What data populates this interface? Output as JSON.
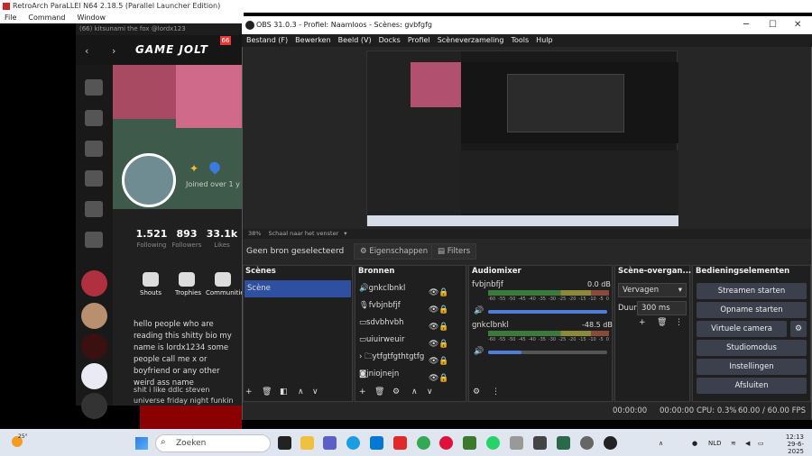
{
  "retroarch": {
    "title": "RetroArch ParaLLEl N64 2.18.5 (Parallel Launcher Edition)",
    "menu": [
      "File",
      "Command",
      "Window"
    ]
  },
  "gamejolt": {
    "tab_text": "(66) kitsunami the fox @lordx123",
    "logo": "GAME JOLT",
    "badge": "66",
    "joined": "Joined over 1 y",
    "stats": [
      {
        "n": "1.521",
        "l": "Following"
      },
      {
        "n": "893",
        "l": "Followers"
      },
      {
        "n": "33.1k",
        "l": "Likes"
      }
    ],
    "tabs": [
      "Shouts",
      "Trophies",
      "Communities"
    ],
    "bio": "hello people who are reading this shitty bio my name is lordx1234 some people call me x or boyfriend or any other weird ass name",
    "bio2": "shit i like ddlc steven universe friday night funkin"
  },
  "obs": {
    "title": "OBS 31.0.3 - Profiel: Naamloos - Scènes: gvbfgfg",
    "menu": [
      "Bestand (F)",
      "Bewerken",
      "Beeld (V)",
      "Docks",
      "Profiel",
      "Scèneverzameling",
      "Tools",
      "Hulp"
    ],
    "scale_pct": "38%",
    "scale_label": "Schaal naar het venster",
    "no_source": "Geen bron geselecteerd",
    "props_btn": "Eigenschappen",
    "filters_btn": "Filters",
    "scenes": {
      "title": "Scènes",
      "items": [
        "Scène"
      ]
    },
    "sources": {
      "title": "Bronnen",
      "items": [
        "gnkclbnkl",
        "fvbjnbfjf",
        "sdvbhvbh",
        "uiuirweuir",
        "ytfgtfgthtgtfg",
        "jniojnejn"
      ]
    },
    "mixer": {
      "title": "Audiomixer",
      "channels": [
        {
          "name": "fvbjnbfjf",
          "db": "0.0 dB",
          "level": 1.0
        },
        {
          "name": "gnkclbnkl",
          "db": "-48.5 dB",
          "level": 0.28
        }
      ],
      "scale": [
        "-60",
        "-55",
        "-50",
        "-45",
        "-40",
        "-35",
        "-30",
        "-25",
        "-20",
        "-15",
        "-10",
        "-5",
        "0"
      ]
    },
    "transitions": {
      "title": "Scène-overgan...",
      "type": "Vervagen",
      "duration_label": "Duur",
      "duration": "300 ms"
    },
    "controls": {
      "title": "Bedieningselementen",
      "buttons": [
        "Streamen starten",
        "Opname starten",
        "Virtuele camera starten",
        "Studiomodus",
        "Instellingen",
        "Afsluiten"
      ]
    },
    "status": {
      "stream_time": "00:00:00",
      "rec_time": "00:00:00",
      "cpu": "CPU: 0.3%",
      "fps": "60.00 / 60.00 FPS"
    }
  },
  "taskbar": {
    "weather": "25°",
    "search": "Zoeken",
    "lang": "NLD",
    "time": "12:13",
    "date": "29-6-2025"
  }
}
